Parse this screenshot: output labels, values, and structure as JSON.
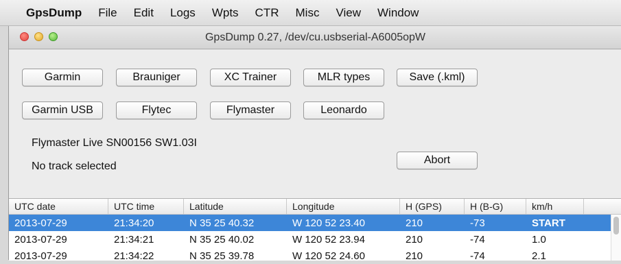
{
  "menubar": {
    "apple_glyph": "",
    "app_name": "GpsDump",
    "items": [
      "File",
      "Edit",
      "Logs",
      "Wpts",
      "CTR",
      "Misc",
      "View",
      "Window"
    ]
  },
  "window": {
    "title": "GpsDump 0.27, /dev/cu.usbserial-A6005opW"
  },
  "buttons_row1": [
    "Garmin",
    "Brauniger",
    "XC Trainer",
    "MLR types",
    "Save (.kml)"
  ],
  "buttons_row2": [
    "Garmin USB",
    "Flytec",
    "Flymaster",
    "Leonardo"
  ],
  "device_info": "Flymaster Live  SN00156  SW1.03I",
  "track_status": "No track selected",
  "abort_label": "Abort",
  "table": {
    "columns": [
      "UTC date",
      "UTC time",
      "Latitude",
      "Longitude",
      "H (GPS)",
      "H (B-G)",
      "km/h"
    ],
    "rows": [
      [
        "2013-07-29",
        "21:34:20",
        "N 35  25  40.32",
        "W 120  52  23.40",
        "210",
        "-73",
        "START"
      ],
      [
        "2013-07-29",
        "21:34:21",
        "N 35  25  40.02",
        "W 120  52  23.94",
        "210",
        "-74",
        "1.0"
      ],
      [
        "2013-07-29",
        "21:34:22",
        "N 35  25  39.78",
        "W 120  52  24.60",
        "210",
        "-74",
        "2.1"
      ]
    ]
  },
  "colors": {
    "selection": "#3d86d8"
  }
}
